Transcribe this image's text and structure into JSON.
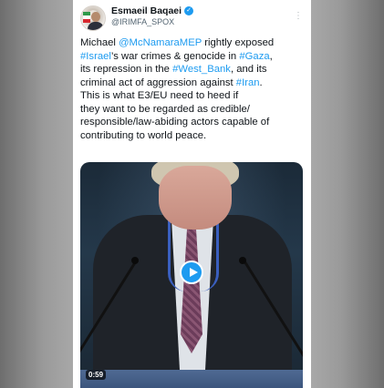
{
  "author": {
    "name": "Esmaeil Baqaei",
    "handle": "@IRIMFA_SPOX",
    "verified": true
  },
  "tweet": {
    "lines": [
      [
        {
          "t": "Michael ",
          "tag": false
        },
        {
          "t": "@McNamaraMEP",
          "tag": true
        },
        {
          "t": " rightly exposed",
          "tag": false
        }
      ],
      [
        {
          "t": "#Israel",
          "tag": true
        },
        {
          "t": "’s war crimes & genocide in ",
          "tag": false
        },
        {
          "t": "#Gaza",
          "tag": true
        },
        {
          "t": ",",
          "tag": false
        }
      ],
      [
        {
          "t": "its repression in the ",
          "tag": false
        },
        {
          "t": "#West_Bank",
          "tag": true
        },
        {
          "t": ", and its",
          "tag": false
        }
      ],
      [
        {
          "t": "criminal act of aggression against ",
          "tag": false
        },
        {
          "t": "#Iran",
          "tag": true
        },
        {
          "t": ".",
          "tag": false
        }
      ],
      [
        {
          "t": "This is what E3/EU need to heed if",
          "tag": false
        }
      ],
      [
        {
          "t": "they want to be regarded as credible/",
          "tag": false
        }
      ],
      [
        {
          "t": "responsible/law-abiding actors capable of",
          "tag": false
        }
      ],
      [
        {
          "t": "contributing to world peace.",
          "tag": false
        }
      ]
    ]
  },
  "video": {
    "duration": "0:59"
  },
  "colors": {
    "link": "#1d9bf0",
    "text": "#0f1419",
    "handle": "#536471"
  },
  "icons": {
    "verified": "verified-badge-icon",
    "more": "more-options-icon",
    "play": "play-icon"
  }
}
